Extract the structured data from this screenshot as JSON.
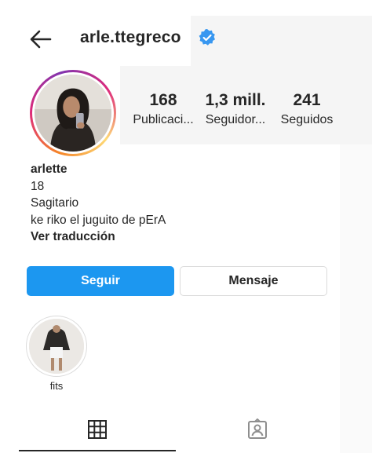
{
  "header": {
    "username": "arle.ttegreco",
    "back_icon": "arrow-left-icon",
    "verified_icon": "verified-badge-icon",
    "verified_color": "#3897f0"
  },
  "stats": [
    {
      "number": "168",
      "label": "Publicaci..."
    },
    {
      "number": "1,3 mill.",
      "label": "Seguidor..."
    },
    {
      "number": "241",
      "label": "Seguidos"
    }
  ],
  "bio": {
    "name": "arlette",
    "line1": "18",
    "line2": "Sagitario",
    "line3": "ke riko el juguito de pErA",
    "translate": "Ver traducción"
  },
  "buttons": {
    "follow": "Seguir",
    "message": "Mensaje",
    "follow_color": "#1c97f0"
  },
  "highlights": [
    {
      "label": "fits"
    }
  ],
  "tabs": {
    "grid_icon": "grid-icon",
    "tagged_icon": "tagged-person-icon",
    "active": "grid"
  }
}
